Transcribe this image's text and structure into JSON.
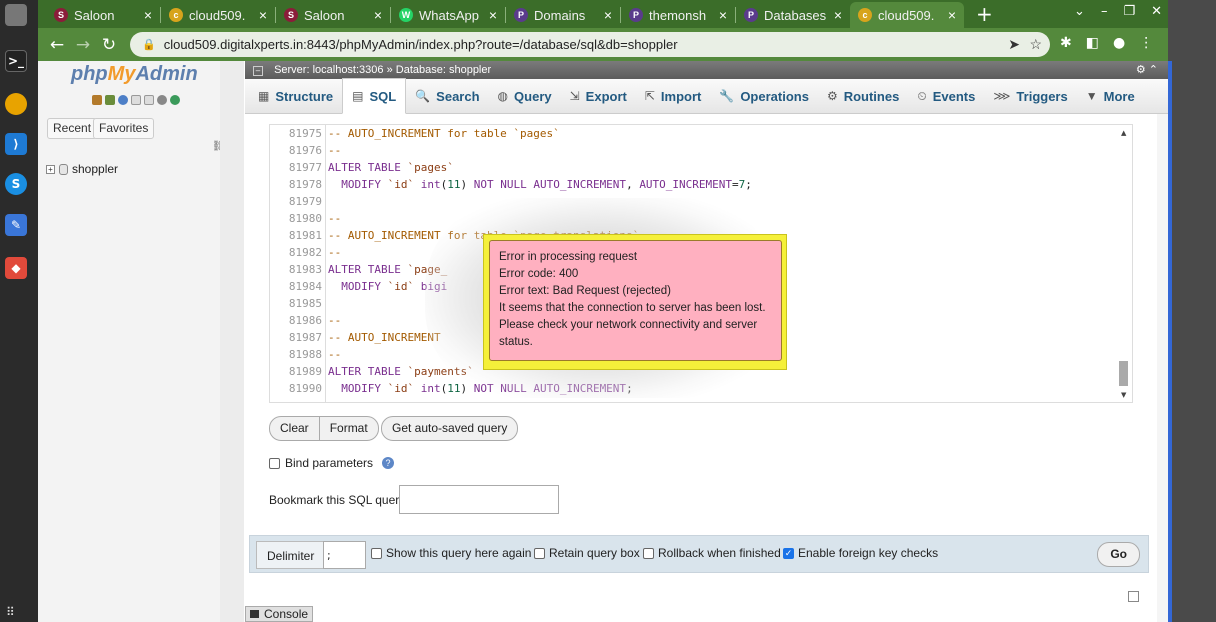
{
  "browser": {
    "tabs": [
      {
        "title": "Saloon",
        "favicon_color": "#8b1d3a",
        "favicon_glyph": "S"
      },
      {
        "title": "cloud509.",
        "favicon_color": "#d7a41c",
        "favicon_glyph": "c"
      },
      {
        "title": "Saloon",
        "favicon_color": "#8b1d3a",
        "favicon_glyph": "S"
      },
      {
        "title": "WhatsApp",
        "favicon_color": "#25d366",
        "favicon_glyph": "W"
      },
      {
        "title": "Domains",
        "favicon_color": "#5a3b8c",
        "favicon_glyph": "P"
      },
      {
        "title": "themonsh",
        "favicon_color": "#5a3b8c",
        "favicon_glyph": "P"
      },
      {
        "title": "Databases",
        "favicon_color": "#5a3b8c",
        "favicon_glyph": "P"
      },
      {
        "title": "cloud509.",
        "favicon_color": "#d7a41c",
        "favicon_glyph": "c",
        "active": true
      }
    ],
    "new_tab": "+",
    "url": "cloud509.digitalxperts.in:8443/phpMyAdmin/index.php?route=/database/sql&db=shoppler"
  },
  "sidebar": {
    "logo_php": "php",
    "logo_my": "My",
    "logo_admin": "Admin",
    "recent_label": "Recent",
    "favorites_label": "Favorites",
    "db_name": "shoppler"
  },
  "breadcrumb": {
    "server": "Server: localhost:3306",
    "database": "Database: shoppler"
  },
  "menu_tabs": [
    {
      "label": "Structure",
      "icon": "structure-icon"
    },
    {
      "label": "SQL",
      "icon": "sql-icon",
      "active": true
    },
    {
      "label": "Search",
      "icon": "search-icon"
    },
    {
      "label": "Query",
      "icon": "query-icon"
    },
    {
      "label": "Export",
      "icon": "export-icon"
    },
    {
      "label": "Import",
      "icon": "import-icon"
    },
    {
      "label": "Operations",
      "icon": "operations-icon"
    },
    {
      "label": "Routines",
      "icon": "routines-icon"
    },
    {
      "label": "Events",
      "icon": "events-icon"
    },
    {
      "label": "Triggers",
      "icon": "triggers-icon"
    },
    {
      "label": "More",
      "icon": "more-icon"
    }
  ],
  "sql_lines": [
    {
      "n": "81975",
      "segs": [
        [
          "cm",
          "-- AUTO_INCREMENT for table `pages`"
        ]
      ]
    },
    {
      "n": "81976",
      "segs": [
        [
          "cm",
          "--"
        ]
      ]
    },
    {
      "n": "81977",
      "segs": [
        [
          "kw",
          "ALTER TABLE "
        ],
        [
          "str",
          "`pages`"
        ]
      ]
    },
    {
      "n": "81978",
      "segs": [
        [
          "",
          "  "
        ],
        [
          "kw",
          "MODIFY "
        ],
        [
          "str",
          "`id`"
        ],
        [
          "",
          " "
        ],
        [
          "kw",
          "int"
        ],
        [
          "",
          "("
        ],
        [
          "num",
          "11"
        ],
        [
          "",
          ") "
        ],
        [
          "kw",
          "NOT NULL AUTO_INCREMENT"
        ],
        [
          "",
          ", "
        ],
        [
          "kw",
          "AUTO_INCREMENT"
        ],
        [
          "",
          "="
        ],
        [
          "num",
          "7"
        ],
        [
          "",
          ";"
        ]
      ]
    },
    {
      "n": "81979",
      "segs": []
    },
    {
      "n": "81980",
      "segs": [
        [
          "cm",
          "--"
        ]
      ]
    },
    {
      "n": "81981",
      "segs": [
        [
          "cm",
          "-- AUTO_INCREMENT for table `page_translations`"
        ]
      ]
    },
    {
      "n": "81982",
      "segs": [
        [
          "cm",
          "--"
        ]
      ]
    },
    {
      "n": "81983",
      "segs": [
        [
          "kw",
          "ALTER TABLE "
        ],
        [
          "str",
          "`page_"
        ]
      ]
    },
    {
      "n": "81984",
      "segs": [
        [
          "",
          "  "
        ],
        [
          "kw",
          "MODIFY "
        ],
        [
          "str",
          "`id`"
        ],
        [
          "",
          " "
        ],
        [
          "kw",
          "bigi"
        ]
      ]
    },
    {
      "n": "81985",
      "segs": []
    },
    {
      "n": "81986",
      "segs": [
        [
          "cm",
          "--"
        ]
      ]
    },
    {
      "n": "81987",
      "segs": [
        [
          "cm",
          "-- AUTO_INCREMENT"
        ]
      ]
    },
    {
      "n": "81988",
      "segs": [
        [
          "cm",
          "--"
        ]
      ]
    },
    {
      "n": "81989",
      "segs": [
        [
          "kw",
          "ALTER TABLE "
        ],
        [
          "str",
          "`payments`"
        ]
      ]
    },
    {
      "n": "81990",
      "segs": [
        [
          "",
          "  "
        ],
        [
          "kw",
          "MODIFY "
        ],
        [
          "str",
          "`id`"
        ],
        [
          "",
          " "
        ],
        [
          "kw",
          "int"
        ],
        [
          "",
          "("
        ],
        [
          "num",
          "11"
        ],
        [
          "",
          ") "
        ],
        [
          "kw",
          "NOT NULL AUTO_INCREMENT"
        ],
        [
          "",
          ";"
        ]
      ]
    }
  ],
  "buttons": {
    "clear": "Clear",
    "format": "Format",
    "autosaved": "Get auto-saved query"
  },
  "bind_parameters_label": "Bind parameters",
  "bookmark_label": "Bookmark this SQL query:",
  "footer": {
    "delimiter_label": "Delimiter",
    "delimiter_value": ";",
    "show_query": "Show this query here again",
    "retain": "Retain query box",
    "rollback": "Rollback when finished",
    "foreign_keys": "Enable foreign key checks",
    "go": "Go"
  },
  "console_label": "Console",
  "error": {
    "line1": "Error in processing request",
    "line2": "Error code: 400",
    "line3": "Error text: Bad Request (rejected)",
    "line4": "It seems that the connection to server has been lost.",
    "line5": "Please check your network connectivity and server",
    "line6": "status."
  }
}
